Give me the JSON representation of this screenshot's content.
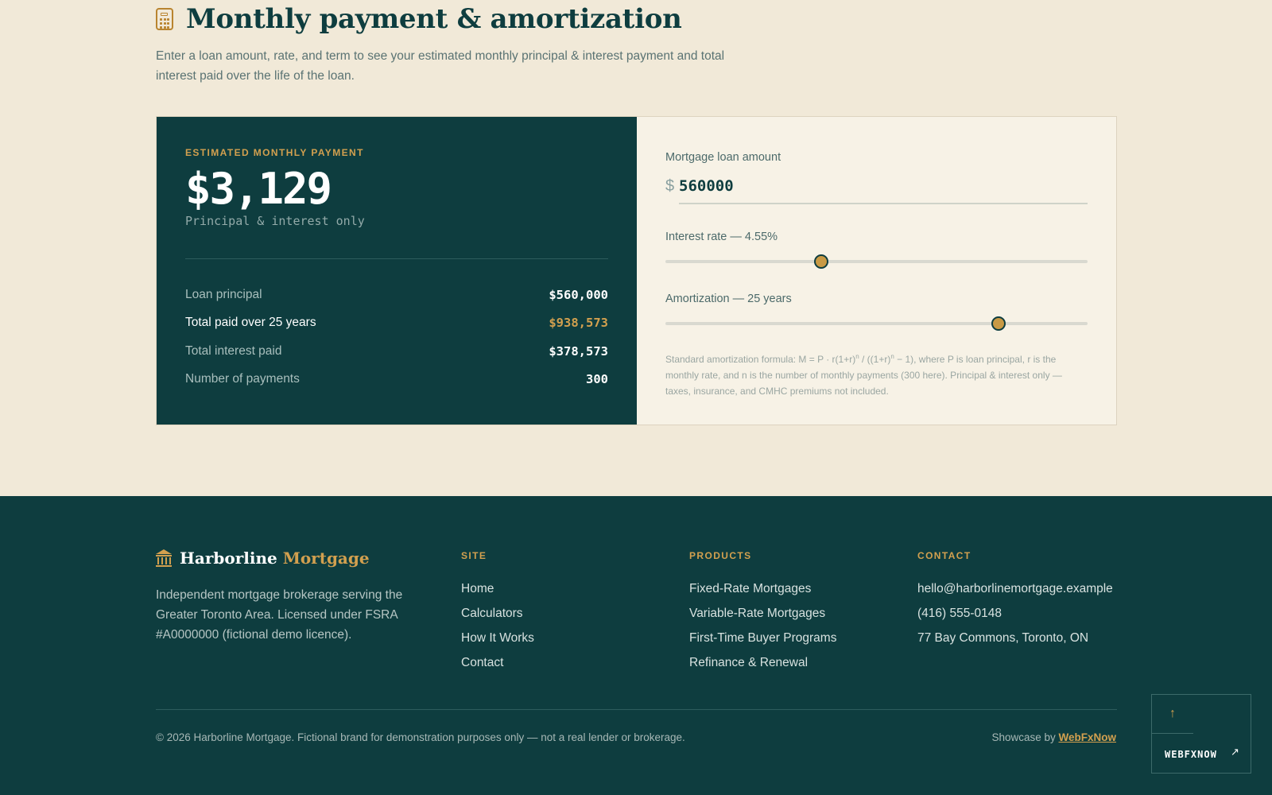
{
  "heading": {
    "icon": "calculator-icon",
    "title": "Monthly payment & amortization",
    "subtitle": "Enter a loan amount, rate, and term to see your estimated monthly principal & interest payment and total interest paid over the life of the loan."
  },
  "results": {
    "label": "ESTIMATED MONTHLY PAYMENT",
    "monthly_payment": "$3,129",
    "note": "Principal & interest only",
    "rows": [
      {
        "label": "Loan principal",
        "value": "$560,000"
      },
      {
        "label": "Total paid over 25 years",
        "value": "$938,573"
      },
      {
        "label": "Total interest paid",
        "value": "$378,573"
      },
      {
        "label": "Number of payments",
        "value": "300"
      }
    ]
  },
  "inputs": {
    "amount_label": "Mortgage loan amount",
    "currency_symbol": "$",
    "amount_value": "560000",
    "rate_label": "Interest rate — 4.55%",
    "rate_slider_fraction": 0.369,
    "term_label": "Amortization — 25 years",
    "term_slider_fraction": 0.789,
    "formula_note": {
      "p1": "Standard amortization formula: M = P · r(1+r)",
      "sup1": "n",
      "p2": " / ((1+r)",
      "sup2": "n",
      "p3": " − 1), where P is loan principal, r is the monthly rate, and n is the number of monthly payments (300 here). Principal & interest only — taxes, insurance, and CMHC premiums not included."
    }
  },
  "footer": {
    "brand_icon": "bank-icon",
    "brand_name": "Harborline",
    "brand_accent": "Mortgage",
    "brand_desc": "Independent mortgage brokerage serving the Greater Toronto Area. Licensed under FSRA #A0000000 (fictional demo licence).",
    "site": {
      "heading": "SITE",
      "links": [
        "Home",
        "Calculators",
        "How It Works",
        "Contact"
      ]
    },
    "products": {
      "heading": "PRODUCTS",
      "links": [
        "Fixed-Rate Mortgages",
        "Variable-Rate Mortgages",
        "First-Time Buyer Programs",
        "Refinance & Renewal"
      ]
    },
    "contact": {
      "heading": "CONTACT",
      "items": [
        "hello@harborlinemortgage.example",
        "(416) 555-0148",
        "77 Bay Commons, Toronto, ON"
      ]
    },
    "copyright": "© 2026 Harborline Mortgage. Fictional brand for demonstration purposes only — not a real lender or brokerage.",
    "showcase_prefix": "Showcase by ",
    "showcase_link": "WebFxNow"
  },
  "widget": {
    "up_icon": "arrow-up-icon",
    "label": "WEBFXNOW",
    "arrow_icon": "arrow-up-right-icon"
  },
  "colors": {
    "brand_dark": "#0e3d3f",
    "accent_gold": "#d2a04f",
    "page_bg": "#f1e9d8",
    "panel_bg": "#f7f2e6"
  }
}
